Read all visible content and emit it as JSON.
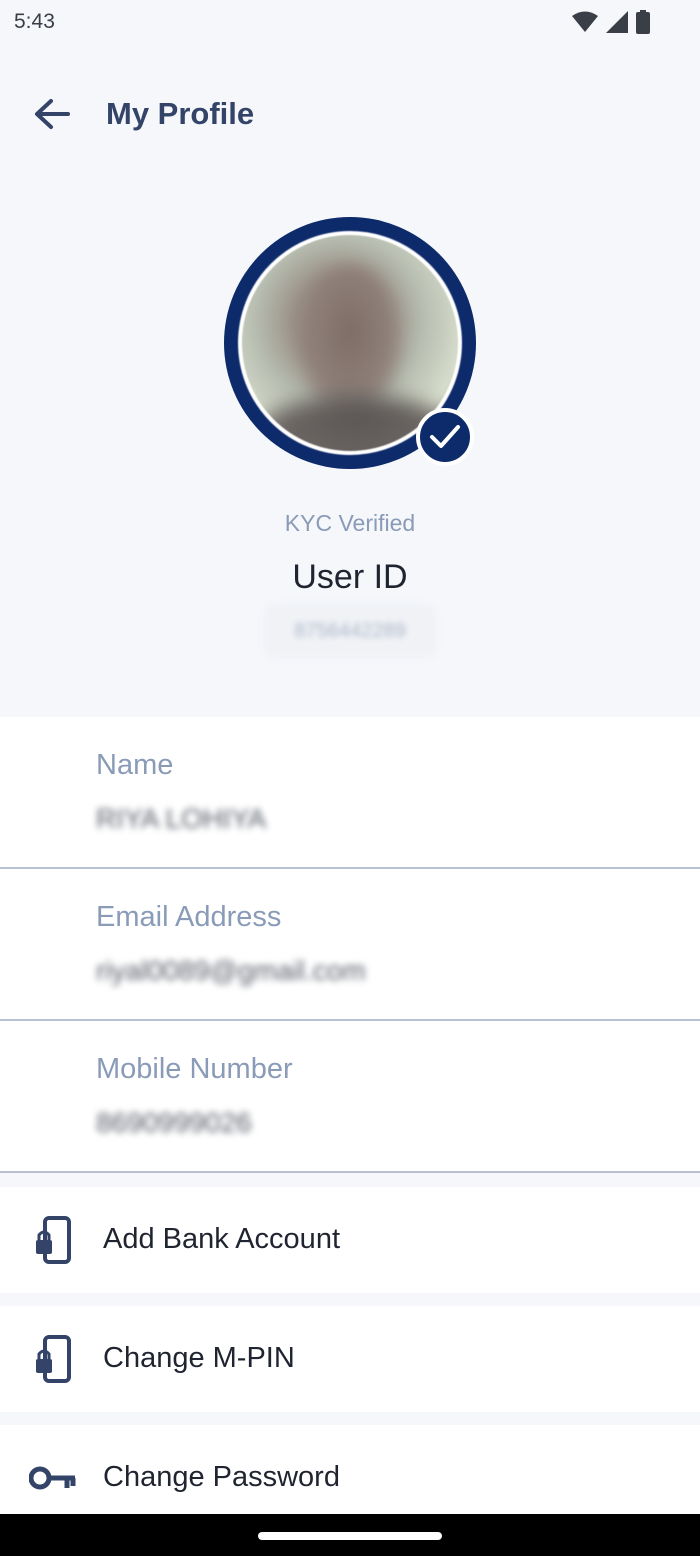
{
  "status_bar": {
    "time": "5:43",
    "icons": [
      "wifi-icon",
      "cellular-signal-icon",
      "battery-icon"
    ]
  },
  "app_bar": {
    "title": "My Profile",
    "back_icon": "arrow-left-icon"
  },
  "profile": {
    "kyc_status": "KYC Verified",
    "user_id_label": "User ID",
    "user_id_value": "8756442289",
    "verified_icon": "checkmark-icon"
  },
  "fields": [
    {
      "label": "Name",
      "value": "RIYA LOHIYA"
    },
    {
      "label": "Email Address",
      "value": "riyal0089@gmail.com"
    },
    {
      "label": "Mobile Number",
      "value": "8690999026"
    }
  ],
  "actions": [
    {
      "label": "Add Bank Account",
      "icon": "phone-lock-icon"
    },
    {
      "label": "Change M-PIN",
      "icon": "phone-lock-icon"
    },
    {
      "label": "Change Password",
      "icon": "key-icon"
    }
  ],
  "colors": {
    "accent": "#0d2a6b",
    "title": "#334468",
    "muted_label": "#8a9bb8",
    "background": "#f5f7fb",
    "divider": "#b7c1d1"
  }
}
